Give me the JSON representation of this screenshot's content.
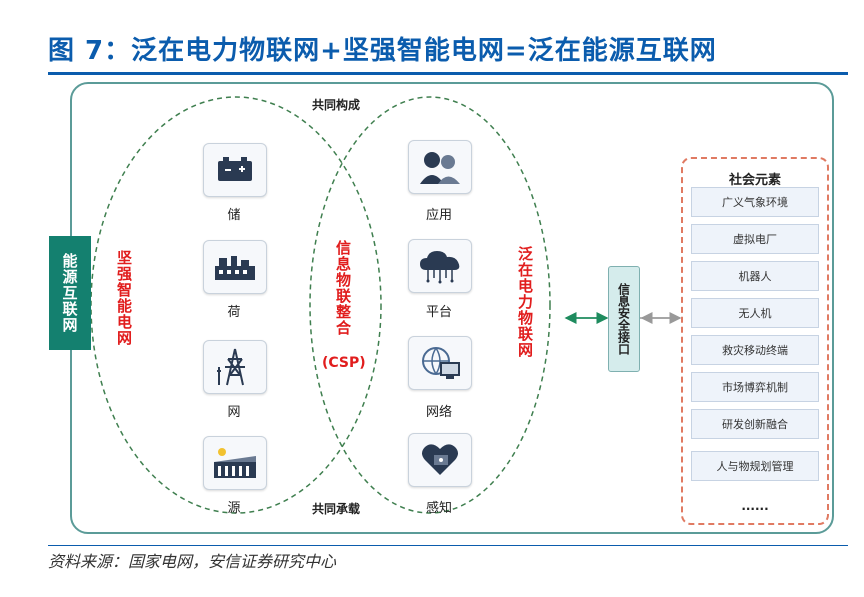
{
  "title": "图 7：泛在电力物联网+坚强智能电网=泛在能源互联网",
  "top_label": "共同构成",
  "bottom_label": "共同承载",
  "side_label": "能源互联网",
  "left_ellipse_label": "坚强智能电网",
  "right_ellipse_label": "泛在电力物联网",
  "center_label": "信息物联整合",
  "center_sub": "(CSP)",
  "left_items": [
    {
      "label": "储",
      "icon": "battery-icon"
    },
    {
      "label": "荷",
      "icon": "factory-icon"
    },
    {
      "label": "网",
      "icon": "power-tower-icon"
    },
    {
      "label": "源",
      "icon": "dam-icon"
    }
  ],
  "right_items": [
    {
      "label": "应用",
      "icon": "users-icon"
    },
    {
      "label": "平台",
      "icon": "cloud-icon"
    },
    {
      "label": "网络",
      "icon": "monitor-globe-icon"
    },
    {
      "label": "感知",
      "icon": "sensor-heart-icon"
    }
  ],
  "interface_label": "信息安全接口",
  "social": {
    "title": "社会元素",
    "items": [
      "广义气象环境",
      "虚拟电厂",
      "机器人",
      "无人机",
      "救灾移动终端",
      "市场博弈机制",
      "研发创新融合",
      "人与物规划管理"
    ],
    "more": "......"
  },
  "source": "资料来源：国家电网，安信证券研究中心",
  "colors": {
    "title": "#0b5cad",
    "accent_red": "#e11d1d",
    "teal": "#14806f",
    "dash_green": "#3f7f4f",
    "social_border": "#e07a62"
  }
}
